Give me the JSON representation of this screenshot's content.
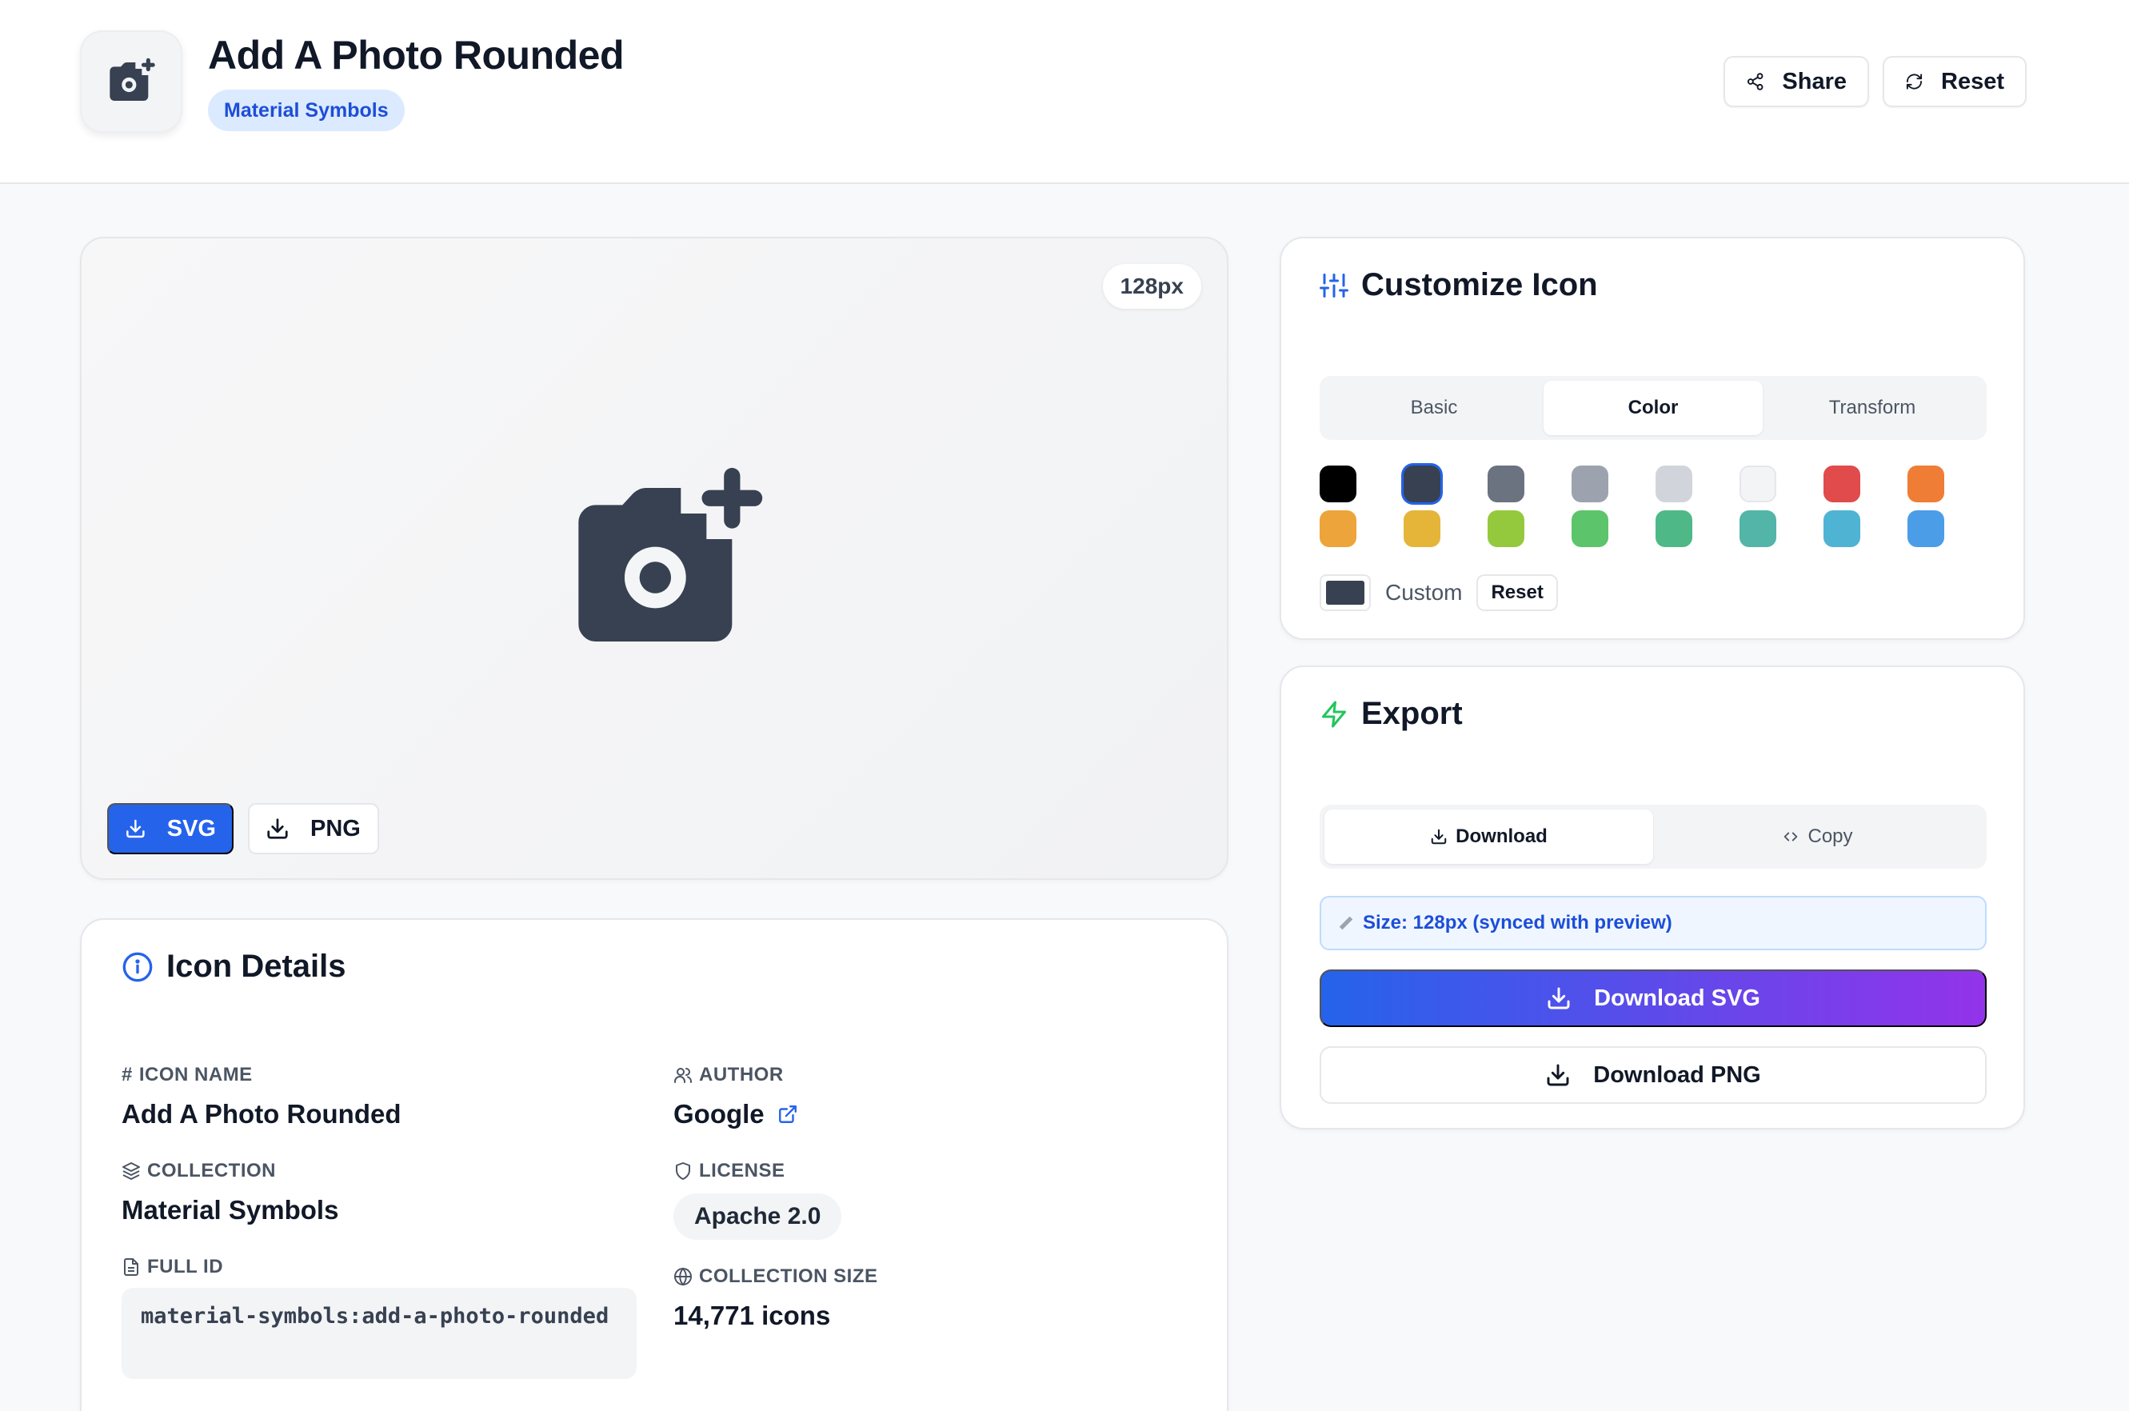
{
  "header": {
    "title": "Add A Photo Rounded",
    "collection_badge": "Material Symbols",
    "share_label": "Share",
    "reset_label": "Reset"
  },
  "preview": {
    "size_badge": "128px",
    "icon": "add-a-photo-icon",
    "svg_button": "SVG",
    "png_button": "PNG"
  },
  "details": {
    "title": "Icon Details",
    "icon_name_label": "ICON NAME",
    "icon_name": "Add A Photo Rounded",
    "author_label": "AUTHOR",
    "author": "Google",
    "collection_label": "COLLECTION",
    "collection": "Material Symbols",
    "license_label": "LICENSE",
    "license": "Apache 2.0",
    "full_id_label": "FULL ID",
    "full_id": "material-symbols:add-a-photo-rounded",
    "collection_size_label": "COLLECTION SIZE",
    "collection_size": "14,771 icons"
  },
  "customize": {
    "title": "Customize Icon",
    "tabs": [
      {
        "label": "Basic",
        "active": false
      },
      {
        "label": "Color",
        "active": true
      },
      {
        "label": "Transform",
        "active": false
      }
    ],
    "swatches": [
      "#000000",
      "#374151",
      "#6b7280",
      "#9ca3af",
      "#d1d5db",
      "#f3f4f6",
      "#e14b4b",
      "#ef7d35",
      "#eda43a",
      "#e5b53a",
      "#95c93d",
      "#5cc46a",
      "#4fb887",
      "#52b5a8",
      "#4fb3d4",
      "#4b9de8"
    ],
    "selected_swatch": "#374151",
    "custom_label": "Custom",
    "custom_color": "#374151",
    "reset_label": "Reset"
  },
  "export": {
    "title": "Export",
    "tabs": [
      {
        "label": "Download",
        "active": true
      },
      {
        "label": "Copy",
        "active": false
      }
    ],
    "size_note": "Size: 128px (synced with preview)",
    "download_svg": "Download SVG",
    "download_png": "Download PNG"
  },
  "colors": {
    "accent": "#2563eb",
    "icon": "#374151",
    "gradient_end": "#9333ea"
  }
}
